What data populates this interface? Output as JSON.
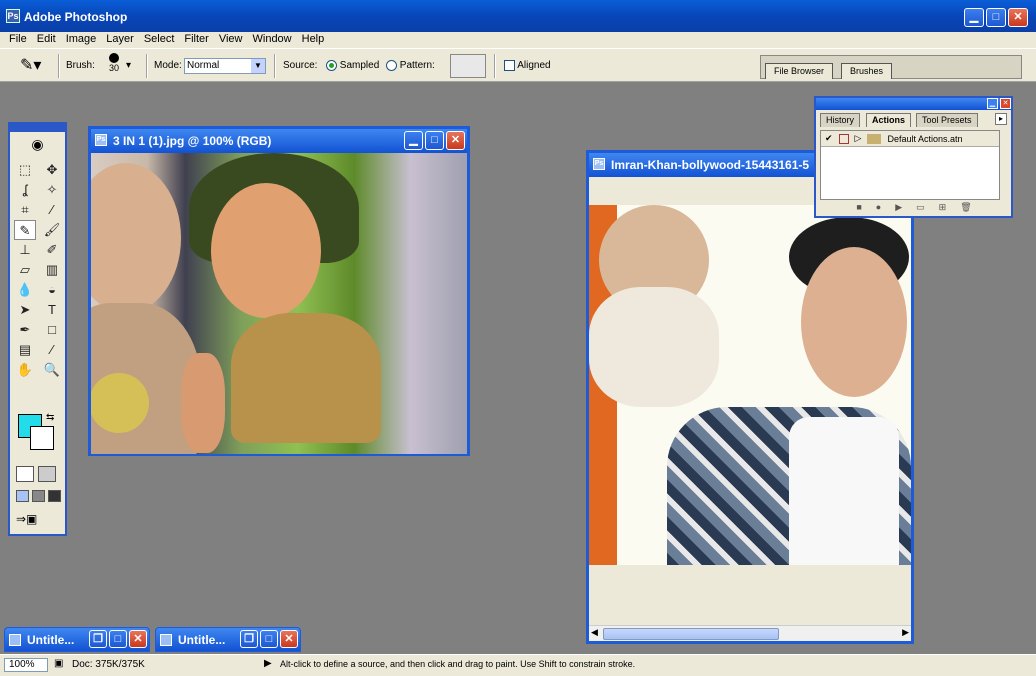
{
  "app": {
    "title": "Adobe Photoshop"
  },
  "menu": [
    "File",
    "Edit",
    "Image",
    "Layer",
    "Select",
    "Filter",
    "View",
    "Window",
    "Help"
  ],
  "options": {
    "brush_label": "Brush:",
    "brush_size": "30",
    "mode_label": "Mode:",
    "mode_value": "Normal",
    "source_label": "Source:",
    "sampled_label": "Sampled",
    "pattern_label": "Pattern:",
    "aligned_label": "Aligned",
    "well_tabs": [
      "File Browser",
      "Brushes"
    ]
  },
  "doc1": {
    "title": "3 IN 1 (1).jpg @ 100% (RGB)"
  },
  "doc2": {
    "title": "Imran-Khan-bollywood-15443161-5"
  },
  "palette": {
    "tabs": [
      "History",
      "Actions",
      "Tool Presets"
    ],
    "active_tab": "Actions",
    "rows": [
      {
        "label": "Default Actions.atn"
      }
    ]
  },
  "minimized": [
    {
      "title": "Untitle..."
    },
    {
      "title": "Untitle..."
    }
  ],
  "status": {
    "zoom": "100%",
    "doc": "Doc: 375K/375K",
    "hint": "Alt-click to define a source, and then click and drag to paint. Use Shift to constrain stroke."
  },
  "colors": {
    "foreground": "#22dcea",
    "background": "#ffffff",
    "title_bar": "#1252d3"
  }
}
